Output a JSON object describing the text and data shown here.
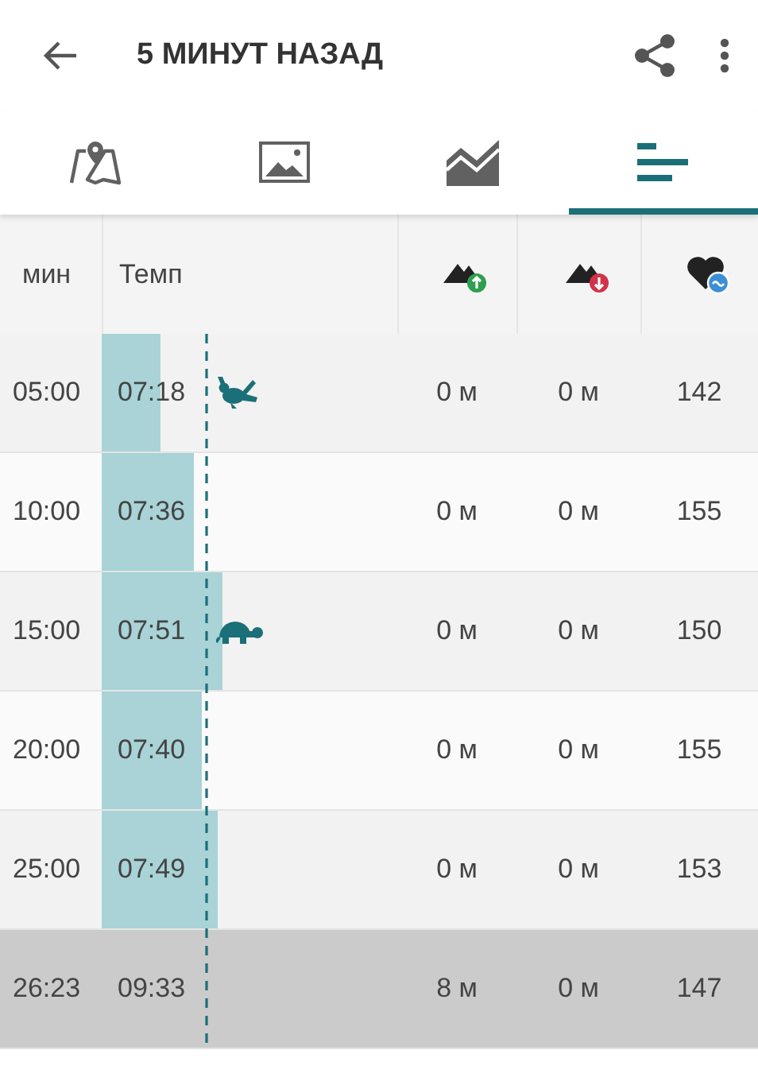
{
  "app_bar": {
    "title": "5 МИНУТ НАЗАД"
  },
  "tabs": [
    {
      "kind": "map",
      "selected": false
    },
    {
      "kind": "photo",
      "selected": false
    },
    {
      "kind": "chart",
      "selected": false
    },
    {
      "kind": "splits",
      "selected": true
    }
  ],
  "table": {
    "columns": [
      {
        "kind": "text",
        "label": "мин"
      },
      {
        "kind": "text",
        "label": "Темп"
      },
      {
        "kind": "ascent"
      },
      {
        "kind": "descent"
      },
      {
        "kind": "heart-rate"
      }
    ],
    "rows": [
      {
        "kind": "split",
        "time": "05:00",
        "pace": "07:18",
        "level": 0.2,
        "fastest": true,
        "slowest": false,
        "ascent": "0 м",
        "descent": "0 м",
        "heart_rate": "142"
      },
      {
        "kind": "split",
        "time": "10:00",
        "pace": "07:36",
        "level": 0.31,
        "fastest": false,
        "slowest": false,
        "ascent": "0 м",
        "descent": "0 м",
        "heart_rate": "155"
      },
      {
        "kind": "split",
        "time": "15:00",
        "pace": "07:51",
        "level": 0.41,
        "fastest": false,
        "slowest": true,
        "ascent": "0 м",
        "descent": "0 м",
        "heart_rate": "150"
      },
      {
        "kind": "split",
        "time": "20:00",
        "pace": "07:40",
        "level": 0.34,
        "fastest": false,
        "slowest": false,
        "ascent": "0 м",
        "descent": "0 м",
        "heart_rate": "155"
      },
      {
        "kind": "split",
        "time": "25:00",
        "pace": "07:49",
        "level": 0.39,
        "fastest": false,
        "slowest": false,
        "ascent": "0 м",
        "descent": "0 м",
        "heart_rate": "153"
      },
      {
        "kind": "partial",
        "time": "26:23",
        "pace": "09:33",
        "fastest": false,
        "slowest": false,
        "ascent": "8 м",
        "descent": "0 м",
        "heart_rate": "147"
      }
    ]
  }
}
